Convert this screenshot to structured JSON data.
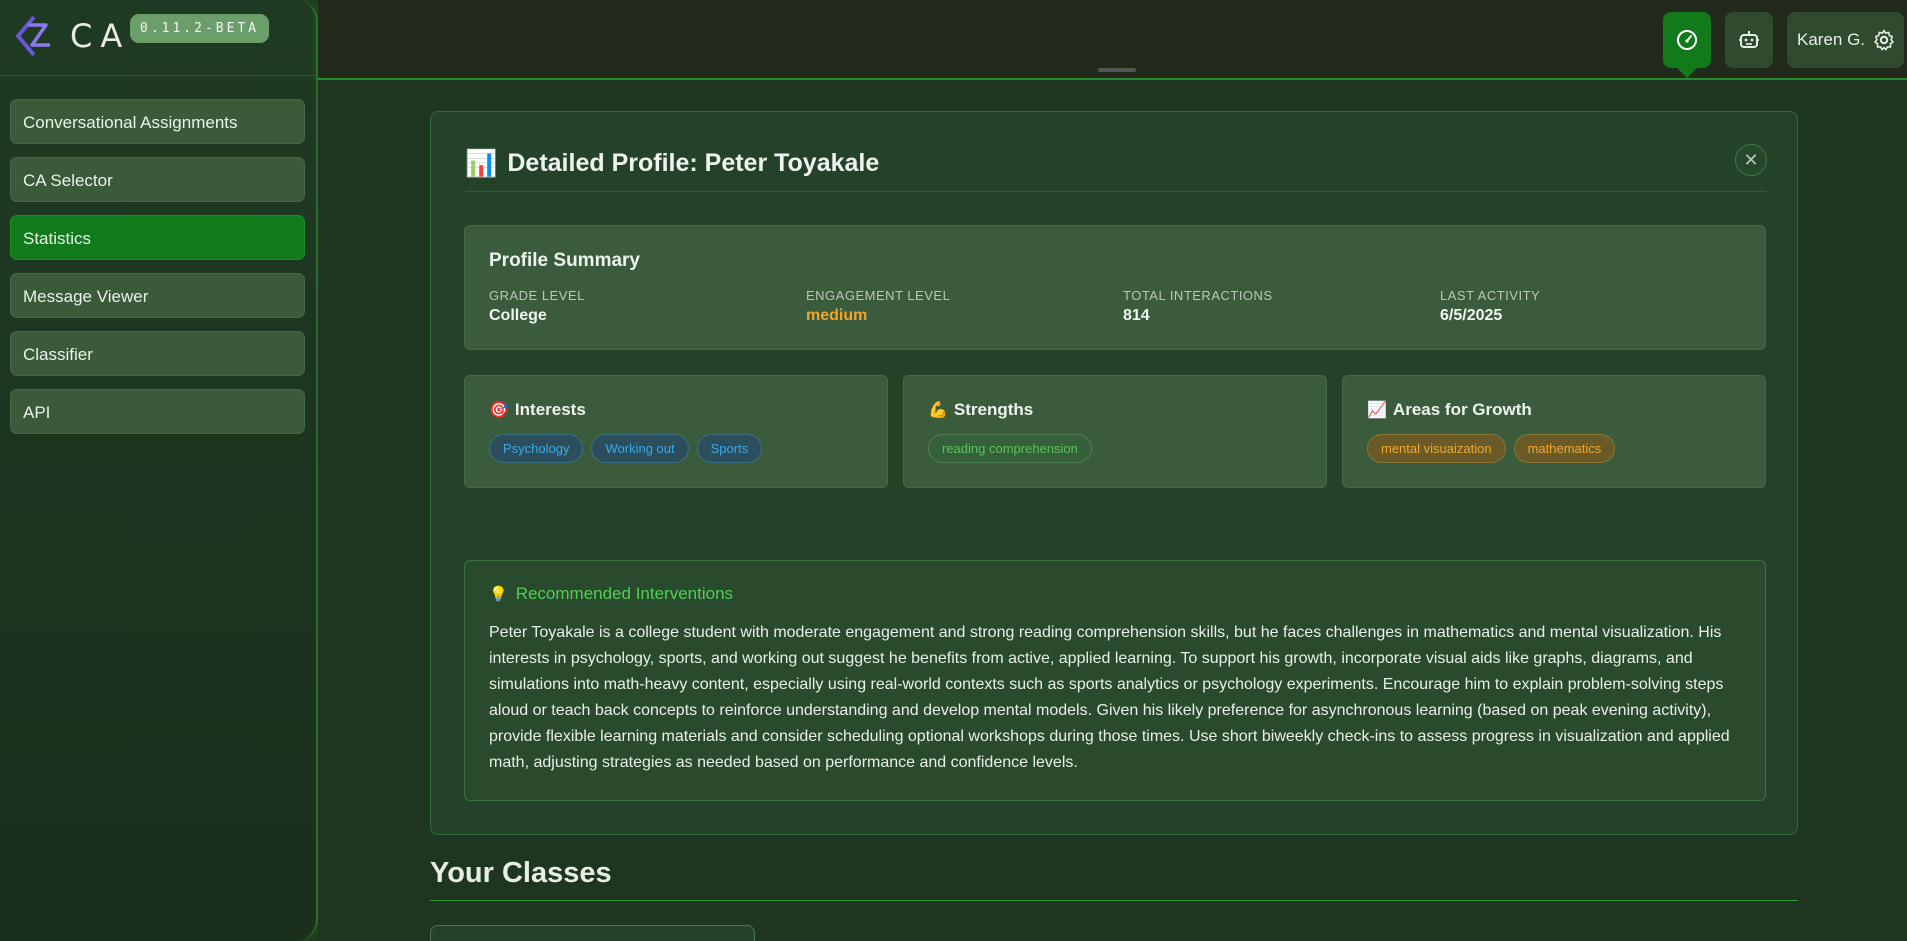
{
  "brand": {
    "name": "CA",
    "version": "0.11.2-BETA"
  },
  "sidebar": {
    "items": [
      {
        "label": "Conversational Assignments",
        "active": false
      },
      {
        "label": "CA Selector",
        "active": false
      },
      {
        "label": "Statistics",
        "active": true
      },
      {
        "label": "Message Viewer",
        "active": false
      },
      {
        "label": "Classifier",
        "active": false
      },
      {
        "label": "API",
        "active": false
      }
    ]
  },
  "topbar": {
    "user_name": "Karen G.",
    "icons": [
      "dashboard-icon",
      "robot-icon",
      "gear-icon"
    ]
  },
  "profile": {
    "title_emoji": "📊",
    "title": "Detailed Profile: Peter Toyakale",
    "close_glyph": "✕",
    "summary": {
      "title": "Profile Summary",
      "fields": [
        {
          "label": "GRADE LEVEL",
          "value": "College"
        },
        {
          "label": "ENGAGEMENT LEVEL",
          "value": "medium"
        },
        {
          "label": "TOTAL INTERACTIONS",
          "value": "814"
        },
        {
          "label": "LAST ACTIVITY",
          "value": "6/5/2025"
        }
      ]
    },
    "interests": {
      "emoji": "🎯",
      "title": "Interests",
      "tags": [
        "Psychology",
        "Working out",
        "Sports"
      ]
    },
    "strengths": {
      "emoji": "💪",
      "title": "Strengths",
      "tags": [
        "reading comprehension"
      ]
    },
    "growth": {
      "emoji": "📈",
      "title": "Areas for Growth",
      "tags": [
        "mental visuaization",
        "mathematics"
      ]
    },
    "interventions": {
      "emoji": "💡",
      "title": "Recommended Interventions",
      "text": "Peter Toyakale is a college student with moderate engagement and strong reading comprehension skills, but he faces challenges in mathematics and mental visualization. His interests in psychology, sports, and working out suggest he benefits from active, applied learning. To support his growth, incorporate visual aids like graphs, diagrams, and simulations into math-heavy content, especially using real-world contexts such as sports analytics or psychology experiments. Encourage him to explain problem-solving steps aloud or teach back concepts to reinforce understanding and develop mental models. Given his likely preference for asynchronous learning (based on peak evening activity), provide flexible learning materials and consider scheduling optional workshops during those times. Use short biweekly check-ins to assess progress in visualization and applied math, adjusting strategies as needed based on performance and confidence levels."
    }
  },
  "classes": {
    "title": "Your Classes"
  },
  "colors": {
    "accent_green": "#117a1a",
    "engagement_medium": "#f3a52a",
    "interest_tag": "#3ca8e8",
    "strength_tag": "#5cc060",
    "growth_tag": "#f2a82a"
  }
}
